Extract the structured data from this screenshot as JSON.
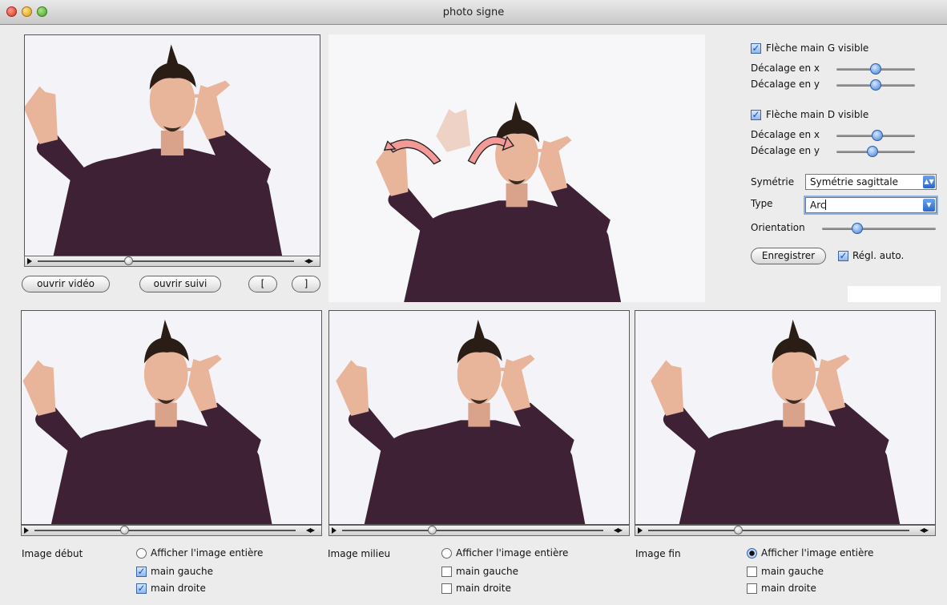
{
  "window": {
    "title": "photo signe"
  },
  "video_panel": {
    "open_video_label": "ouvrir vidéo",
    "open_track_label": "ouvrir suivi",
    "mark_in_label": "[",
    "mark_out_label": "]",
    "step_label": "◀▶"
  },
  "controls": {
    "left_arrow_visible_label": "Flèche main G visible",
    "left_arrow_visible": true,
    "right_arrow_visible_label": "Flèche main D visible",
    "right_arrow_visible": true,
    "offset_x_label": "Décalage en x",
    "offset_y_label": "Décalage en y",
    "symmetry_label": "Symétrie",
    "symmetry_value": "Symétrie sagittale",
    "type_label": "Type",
    "type_value": "Arc",
    "orientation_label": "Orientation",
    "save_label": "Enregistrer",
    "auto_adjust_label": "Régl. auto.",
    "auto_adjust": true
  },
  "frames": [
    {
      "label": "Image début",
      "show_full_label": "Afficher l'image entière",
      "show_full": false,
      "left_hand_label": "main gauche",
      "left_hand": true,
      "right_hand_label": "main droite",
      "right_hand": true
    },
    {
      "label": "Image milieu",
      "show_full_label": "Afficher l'image entière",
      "show_full": false,
      "left_hand_label": "main gauche",
      "left_hand": false,
      "right_hand_label": "main droite",
      "right_hand": false
    },
    {
      "label": "Image fin",
      "show_full_label": "Afficher l'image entière",
      "show_full": true,
      "left_hand_label": "main gauche",
      "left_hand": false,
      "right_hand_label": "main droite",
      "right_hand": false
    }
  ],
  "colors": {
    "sweater": "#3e2135",
    "skin": "#e8b49a",
    "hair": "#2a1d16",
    "arrow_fill": "#f39a97",
    "accent": "#3f7fd6"
  },
  "icons": {
    "window_close": "close-icon",
    "window_minimize": "minimize-icon",
    "window_zoom": "zoom-icon",
    "play": "play-icon"
  }
}
